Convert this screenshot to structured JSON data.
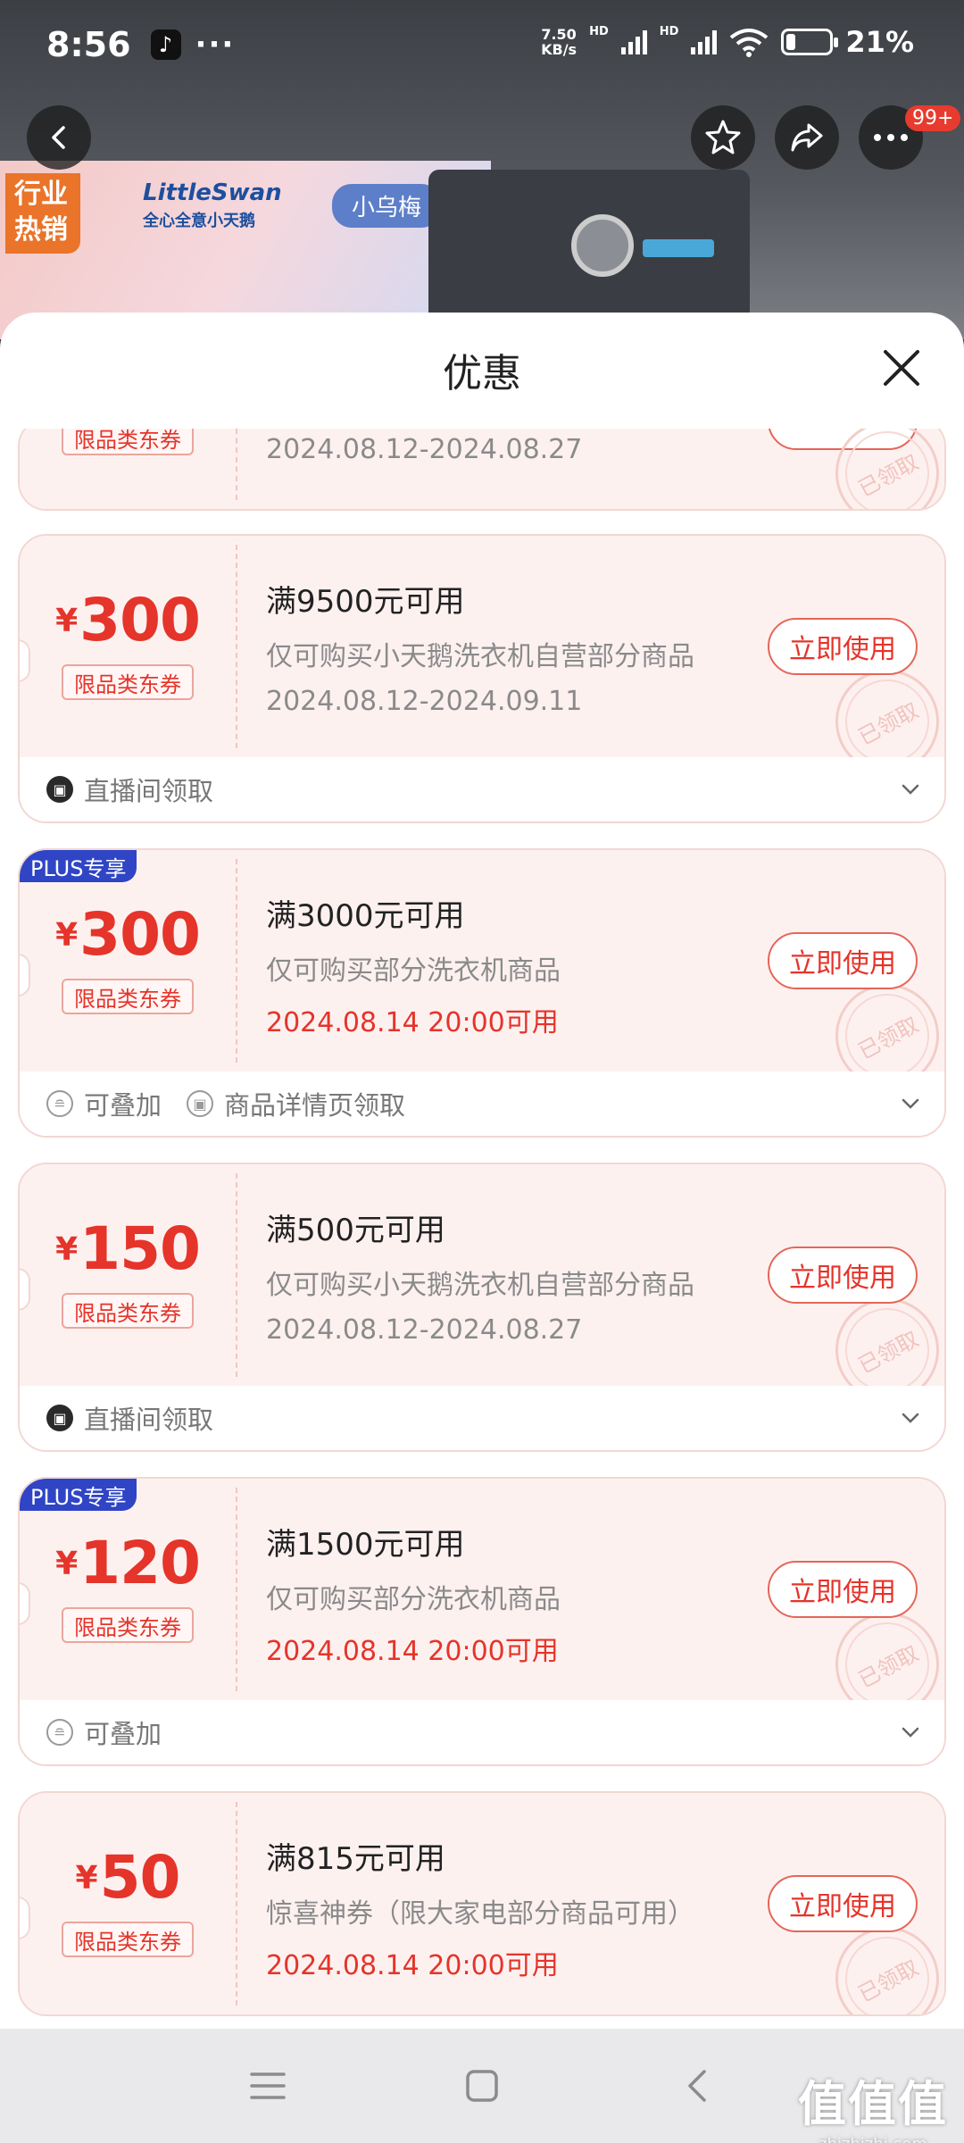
{
  "status_bar": {
    "time": "8:56",
    "app_icon": "tiktok-icon",
    "more": "···",
    "net_speed_value": "7.50",
    "net_speed_unit": "KB/s",
    "hd1": "HD",
    "hd2": "HD",
    "battery": "21%",
    "battery_level": 0.21
  },
  "product_nav": {
    "back_icon": "back-icon",
    "favorite_icon": "star-icon",
    "share_icon": "share-icon",
    "more_icon": "more-icon",
    "badge": "99+"
  },
  "banner": {
    "hot_line1": "行业",
    "hot_line2": "热销",
    "brand_line1": "LittleSwan",
    "brand_line2": "全心全意小天鹅",
    "pill": "小乌梅"
  },
  "sheet": {
    "title": "优惠",
    "close_icon": "close-icon"
  },
  "coupons": [
    {
      "tag": "限品类东券",
      "period": "2024.08.12-2024.08.27",
      "stamp": "已领取"
    },
    {
      "currency": "¥",
      "amount": "300",
      "tag": "限品类东券",
      "condition": "满9500元可用",
      "scope": "仅可购买小天鹅洗衣机自营部分商品",
      "period": "2024.08.12-2024.09.11",
      "button": "立即使用",
      "stamp": "已领取",
      "foot": [
        "直播间领取"
      ]
    },
    {
      "plus": "PLUS专享",
      "currency": "¥",
      "amount": "300",
      "tag": "限品类东券",
      "condition": "满3000元可用",
      "scope": "仅可购买部分洗衣机商品",
      "period": "2024.08.14 20:00可用",
      "button": "立即使用",
      "stamp": "已领取",
      "foot": [
        "可叠加",
        "商品详情页领取"
      ]
    },
    {
      "currency": "¥",
      "amount": "150",
      "tag": "限品类东券",
      "condition": "满500元可用",
      "scope": "仅可购买小天鹅洗衣机自营部分商品",
      "period": "2024.08.12-2024.08.27",
      "button": "立即使用",
      "stamp": "已领取",
      "foot": [
        "直播间领取"
      ]
    },
    {
      "plus": "PLUS专享",
      "currency": "¥",
      "amount": "120",
      "tag": "限品类东券",
      "condition": "满1500元可用",
      "scope": "仅可购买部分洗衣机商品",
      "period": "2024.08.14 20:00可用",
      "button": "立即使用",
      "stamp": "已领取",
      "foot": [
        "可叠加"
      ]
    },
    {
      "currency": "¥",
      "amount": "50",
      "tag": "限品类东券",
      "condition": "满815元可用",
      "scope": "惊喜神券（限大家电部分商品可用）",
      "period": "2024.08.14 20:00可用",
      "button": "立即使用",
      "stamp": "已领取"
    }
  ],
  "navbar": {
    "menu_icon": "menu-icon",
    "home_icon": "home-icon",
    "back_icon": "back-icon"
  },
  "watermark": {
    "main": "值值值",
    "sub": "zhizhizhi.com"
  },
  "colors": {
    "accent_red": "#e5342a",
    "plus_blue": "#2f45c5",
    "coupon_bg": "#fdf1f0"
  }
}
